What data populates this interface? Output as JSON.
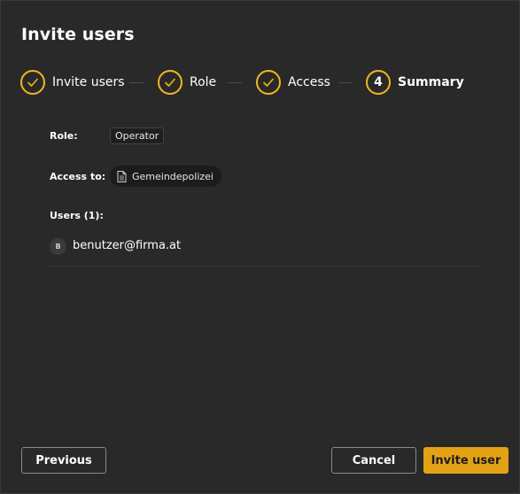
{
  "dialog": {
    "title": "Invite users"
  },
  "stepper": {
    "steps": [
      {
        "label": "Invite users",
        "state": "done",
        "icon": "check-icon"
      },
      {
        "label": "Role",
        "state": "done",
        "icon": "check-icon"
      },
      {
        "label": "Access",
        "state": "done",
        "icon": "check-icon"
      },
      {
        "label": "Summary",
        "state": "current",
        "number": "4"
      }
    ]
  },
  "summary": {
    "role_label": "Role:",
    "role_value": "Operator",
    "access_label": "Access to:",
    "access_value": "Gemeindepolizei",
    "access_icon": "document-icon",
    "users_label": "Users (1):",
    "users": [
      {
        "initial": "B",
        "email": "benutzer@firma.at"
      }
    ]
  },
  "footer": {
    "previous_label": "Previous",
    "cancel_label": "Cancel",
    "invite_label": "Invite user"
  },
  "colors": {
    "accent": "#f2b90f",
    "primary_button": "#e3a30f",
    "background": "#292929"
  }
}
